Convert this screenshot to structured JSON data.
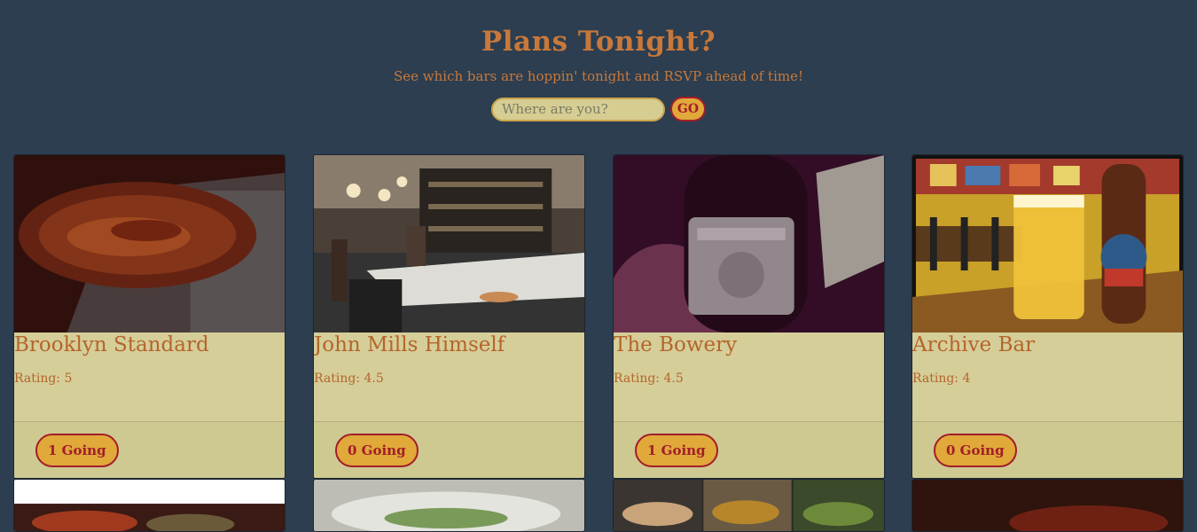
{
  "header": {
    "title": "Plans Tonight?",
    "subtitle": "See which bars are hoppin' tonight and RSVP ahead of time!"
  },
  "search": {
    "placeholder": "Where are you?",
    "go_label": "GO"
  },
  "bars": [
    {
      "name": "Brooklyn Standard",
      "rating": "Rating: 5",
      "going": "1 Going",
      "photo": "plate-of-food-photo"
    },
    {
      "name": "John Mills Himself",
      "rating": "Rating: 4.5",
      "going": "0 Going",
      "photo": "bar-counter-photo"
    },
    {
      "name": "The Bowery",
      "rating": "Rating: 4.5",
      "going": "1 Going",
      "photo": "beer-bottle-photo"
    },
    {
      "name": "Archive Bar",
      "rating": "Rating: 4",
      "going": "0 Going",
      "photo": "beer-glass-photo"
    }
  ],
  "colors": {
    "background": "#2c3e50",
    "accent": "#c8783a",
    "card": "#d5ce98",
    "button": "#e0a93a",
    "button_text": "#a31d2a"
  }
}
